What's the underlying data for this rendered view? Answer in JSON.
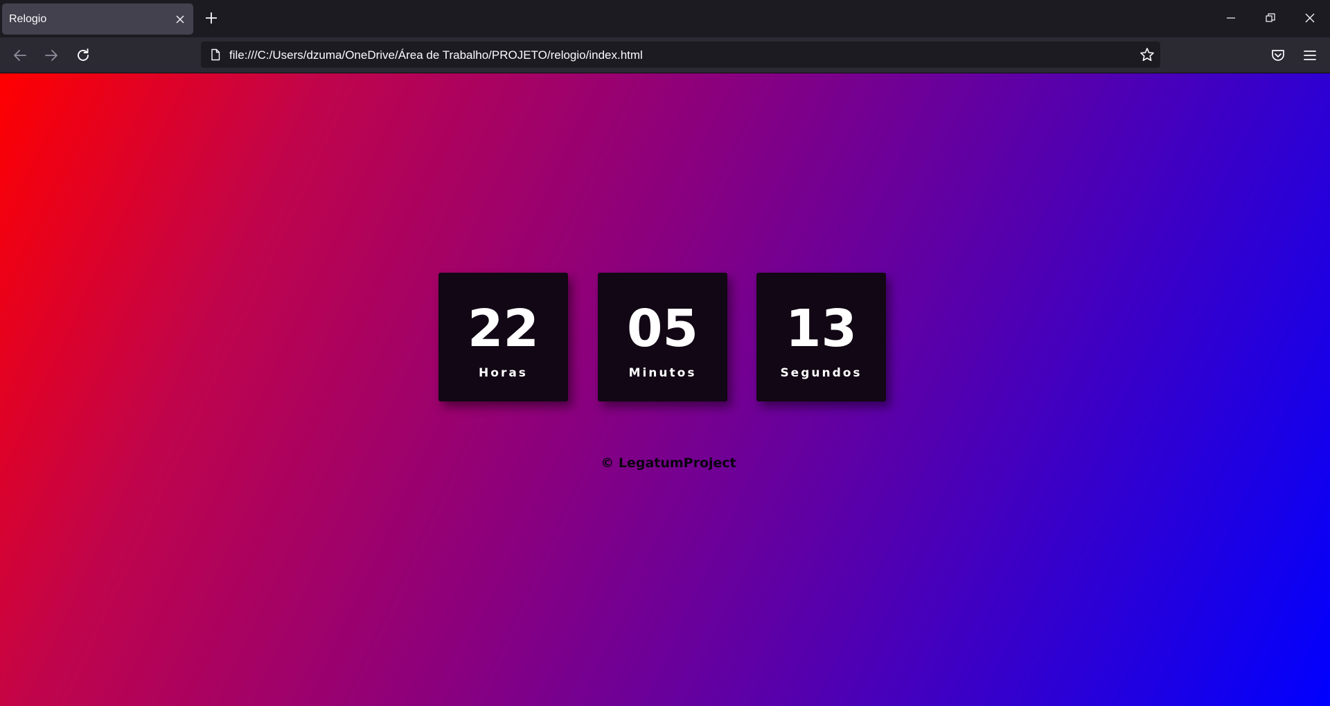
{
  "browser": {
    "tab": {
      "title": "Relogio"
    },
    "address_bar": {
      "url": "file:///C:/Users/dzuma/OneDrive/Área de Trabalho/PROJETO/relogio/index.html"
    },
    "icons": {
      "tab_close": "close-icon",
      "new_tab": "plus-icon",
      "minimize": "minimize-icon",
      "restore": "restore-icon",
      "close": "close-icon",
      "back": "arrow-left-icon",
      "forward": "arrow-right-icon",
      "reload": "reload-icon",
      "page": "page-icon",
      "bookmark": "star-icon",
      "pocket": "pocket-icon",
      "menu": "hamburger-menu-icon"
    }
  },
  "page": {
    "background_colors": [
      "#ff0000",
      "#8a007e",
      "#0000ff"
    ],
    "clock": {
      "hours": {
        "value": "22",
        "label": "Horas"
      },
      "minutes": {
        "value": "05",
        "label": "Minutos"
      },
      "seconds": {
        "value": "13",
        "label": "Segundos"
      }
    },
    "footer": "© LegatumProject"
  }
}
